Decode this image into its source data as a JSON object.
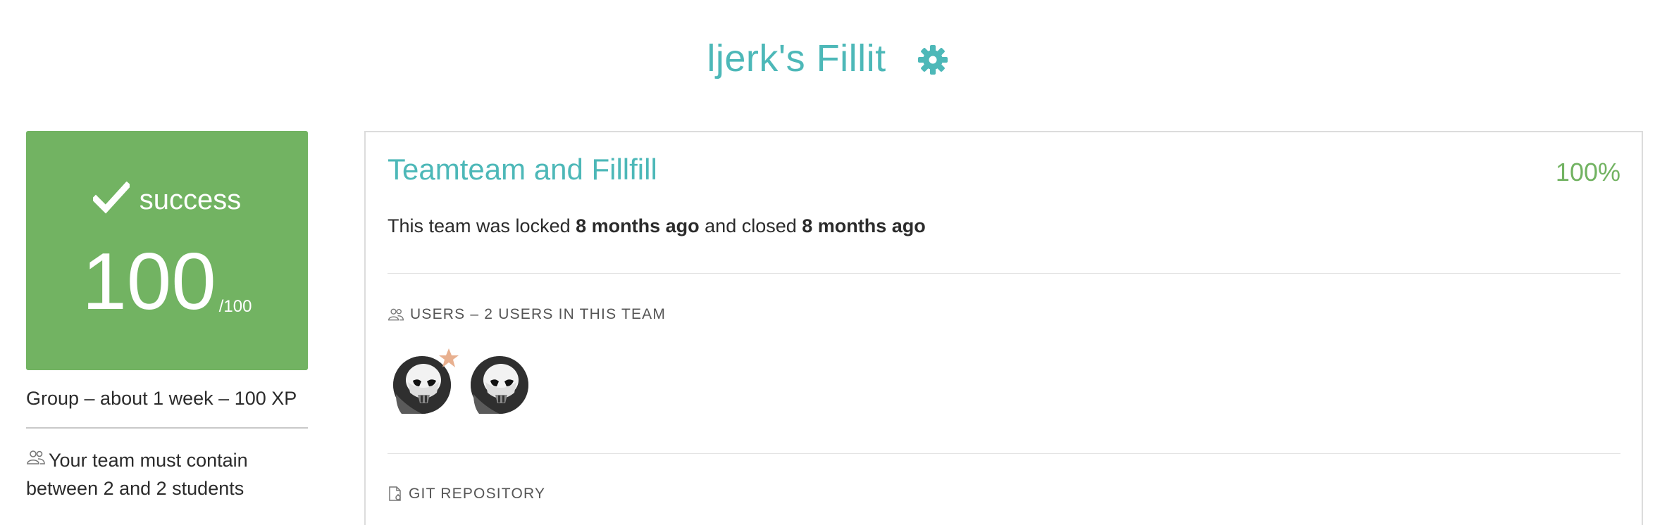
{
  "header": {
    "title": "ljerk's Fillit",
    "settings_icon": "gear-icon",
    "accent_color": "#4db8b8"
  },
  "score_card": {
    "status_icon": "check-icon",
    "status": "success",
    "score": "100",
    "max": "/100",
    "background": "#72b362"
  },
  "project_meta": "Group – about 1 week – 100 XP",
  "team_rule": {
    "icon": "users-icon",
    "text": "Your team must contain between 2 and 2 students"
  },
  "team": {
    "name": "Teamteam and Fillfill",
    "percent": "100%",
    "status_prefix": "This team was locked",
    "locked_ago": "8 months ago",
    "status_middle": "and closed",
    "closed_ago": "8 months ago"
  },
  "users_section": {
    "icon": "users-icon",
    "title": "USERS – 2 USERS IN THIS TEAM",
    "avatars": [
      {
        "name": "avatar-1",
        "leader_icon": "star-icon"
      },
      {
        "name": "avatar-2"
      }
    ]
  },
  "git_section": {
    "icon": "git-file-icon",
    "title": "GIT REPOSITORY"
  }
}
